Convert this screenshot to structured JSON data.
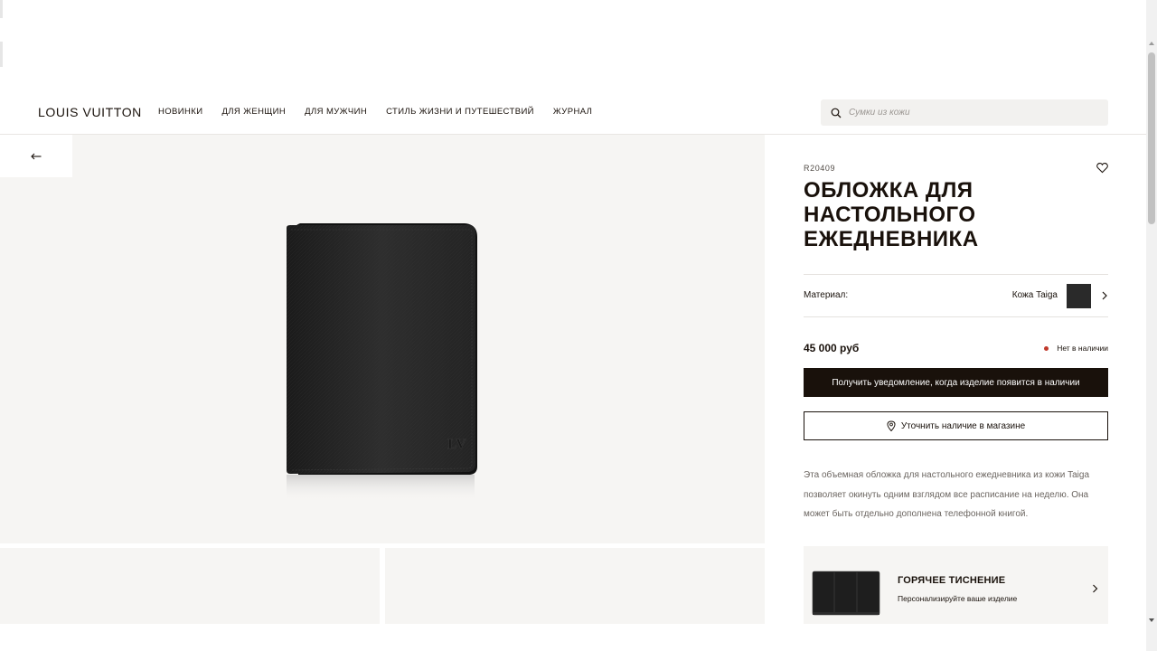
{
  "header": {
    "logo": "LOUIS VUITTON",
    "nav": [
      {
        "label": "НОВИНКИ"
      },
      {
        "label": "ДЛЯ ЖЕНЩИН"
      },
      {
        "label": "ДЛЯ МУЖЧИН"
      },
      {
        "label": "СТИЛЬ ЖИЗНИ И ПУТЕШЕСТВИЙ"
      },
      {
        "label": "ЖУРНАЛ"
      }
    ],
    "search": {
      "placeholder": "Сумки из кожи",
      "value": ""
    }
  },
  "gallery": {
    "back_icon": "arrow-left-icon"
  },
  "product": {
    "sku": "R20409",
    "title": "ОБЛОЖКА ДЛЯ НАСТОЛЬНОГО ЕЖЕДНЕВНИКА",
    "material_label": "Материал:",
    "material_value": "Кожа Taiga",
    "material_color": "#2a2a2a",
    "price": "45 000 руб",
    "availability": "Нет в наличии",
    "availability_color": "#c0392b",
    "notify_button": "Получить уведомление, когда изделие появится в наличии",
    "store_button": "Уточнить наличие в магазине",
    "description": "Эта объемная обложка для настольного ежедневника из кожи Taiga позволяет окинуть одним взглядом все расписание на неделю. Она может быть отдельно дополнена телефонной книгой.",
    "engraving": {
      "title": "ГОРЯЧЕЕ ТИСНЕНИЕ",
      "subtitle": "Персонализируйте ваше изделие"
    }
  },
  "colors": {
    "accent": "#19110b",
    "background_grey": "#f6f5f3"
  }
}
